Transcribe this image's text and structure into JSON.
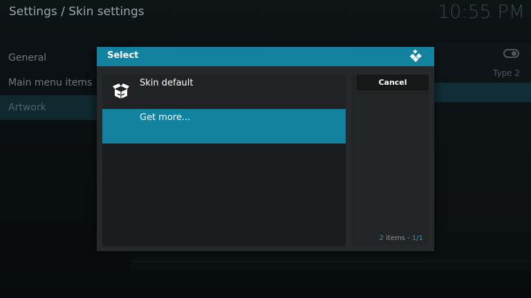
{
  "header": {
    "breadcrumb": "Settings / Skin settings",
    "clock": "10:55 PM"
  },
  "background": {
    "menu": [
      {
        "label": "General",
        "active": false
      },
      {
        "label": "Main menu items",
        "active": false
      },
      {
        "label": "Artwork",
        "active": true
      }
    ],
    "type_value": "Type 2"
  },
  "dialog": {
    "title": "Select",
    "items": [
      {
        "label": "Skin default",
        "icon": "open-box-icon"
      },
      {
        "label": "Get more...",
        "icon": ""
      }
    ],
    "cancel_label": "Cancel",
    "counter": {
      "count": "2",
      "items_word": " items - ",
      "page": "1/1"
    }
  },
  "colors": {
    "accent": "#12829f",
    "dialog_bg": "#26292b",
    "list_bg": "#1b1c1d"
  }
}
